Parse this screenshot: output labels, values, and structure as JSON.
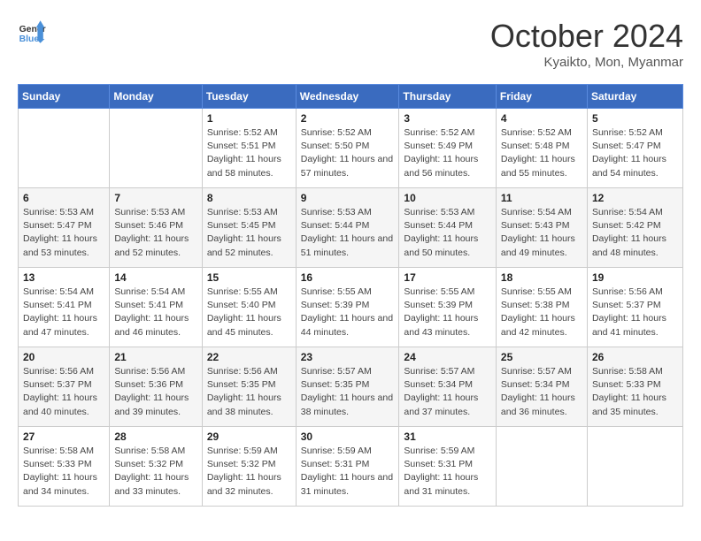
{
  "header": {
    "logo_line1": "General",
    "logo_line2": "Blue",
    "month": "October 2024",
    "location": "Kyaikto, Mon, Myanmar"
  },
  "days_of_week": [
    "Sunday",
    "Monday",
    "Tuesday",
    "Wednesday",
    "Thursday",
    "Friday",
    "Saturday"
  ],
  "weeks": [
    [
      {
        "day": "",
        "sunrise": "",
        "sunset": "",
        "daylight": ""
      },
      {
        "day": "",
        "sunrise": "",
        "sunset": "",
        "daylight": ""
      },
      {
        "day": "1",
        "sunrise": "Sunrise: 5:52 AM",
        "sunset": "Sunset: 5:51 PM",
        "daylight": "Daylight: 11 hours and 58 minutes."
      },
      {
        "day": "2",
        "sunrise": "Sunrise: 5:52 AM",
        "sunset": "Sunset: 5:50 PM",
        "daylight": "Daylight: 11 hours and 57 minutes."
      },
      {
        "day": "3",
        "sunrise": "Sunrise: 5:52 AM",
        "sunset": "Sunset: 5:49 PM",
        "daylight": "Daylight: 11 hours and 56 minutes."
      },
      {
        "day": "4",
        "sunrise": "Sunrise: 5:52 AM",
        "sunset": "Sunset: 5:48 PM",
        "daylight": "Daylight: 11 hours and 55 minutes."
      },
      {
        "day": "5",
        "sunrise": "Sunrise: 5:52 AM",
        "sunset": "Sunset: 5:47 PM",
        "daylight": "Daylight: 11 hours and 54 minutes."
      }
    ],
    [
      {
        "day": "6",
        "sunrise": "Sunrise: 5:53 AM",
        "sunset": "Sunset: 5:47 PM",
        "daylight": "Daylight: 11 hours and 53 minutes."
      },
      {
        "day": "7",
        "sunrise": "Sunrise: 5:53 AM",
        "sunset": "Sunset: 5:46 PM",
        "daylight": "Daylight: 11 hours and 52 minutes."
      },
      {
        "day": "8",
        "sunrise": "Sunrise: 5:53 AM",
        "sunset": "Sunset: 5:45 PM",
        "daylight": "Daylight: 11 hours and 52 minutes."
      },
      {
        "day": "9",
        "sunrise": "Sunrise: 5:53 AM",
        "sunset": "Sunset: 5:44 PM",
        "daylight": "Daylight: 11 hours and 51 minutes."
      },
      {
        "day": "10",
        "sunrise": "Sunrise: 5:53 AM",
        "sunset": "Sunset: 5:44 PM",
        "daylight": "Daylight: 11 hours and 50 minutes."
      },
      {
        "day": "11",
        "sunrise": "Sunrise: 5:54 AM",
        "sunset": "Sunset: 5:43 PM",
        "daylight": "Daylight: 11 hours and 49 minutes."
      },
      {
        "day": "12",
        "sunrise": "Sunrise: 5:54 AM",
        "sunset": "Sunset: 5:42 PM",
        "daylight": "Daylight: 11 hours and 48 minutes."
      }
    ],
    [
      {
        "day": "13",
        "sunrise": "Sunrise: 5:54 AM",
        "sunset": "Sunset: 5:41 PM",
        "daylight": "Daylight: 11 hours and 47 minutes."
      },
      {
        "day": "14",
        "sunrise": "Sunrise: 5:54 AM",
        "sunset": "Sunset: 5:41 PM",
        "daylight": "Daylight: 11 hours and 46 minutes."
      },
      {
        "day": "15",
        "sunrise": "Sunrise: 5:55 AM",
        "sunset": "Sunset: 5:40 PM",
        "daylight": "Daylight: 11 hours and 45 minutes."
      },
      {
        "day": "16",
        "sunrise": "Sunrise: 5:55 AM",
        "sunset": "Sunset: 5:39 PM",
        "daylight": "Daylight: 11 hours and 44 minutes."
      },
      {
        "day": "17",
        "sunrise": "Sunrise: 5:55 AM",
        "sunset": "Sunset: 5:39 PM",
        "daylight": "Daylight: 11 hours and 43 minutes."
      },
      {
        "day": "18",
        "sunrise": "Sunrise: 5:55 AM",
        "sunset": "Sunset: 5:38 PM",
        "daylight": "Daylight: 11 hours and 42 minutes."
      },
      {
        "day": "19",
        "sunrise": "Sunrise: 5:56 AM",
        "sunset": "Sunset: 5:37 PM",
        "daylight": "Daylight: 11 hours and 41 minutes."
      }
    ],
    [
      {
        "day": "20",
        "sunrise": "Sunrise: 5:56 AM",
        "sunset": "Sunset: 5:37 PM",
        "daylight": "Daylight: 11 hours and 40 minutes."
      },
      {
        "day": "21",
        "sunrise": "Sunrise: 5:56 AM",
        "sunset": "Sunset: 5:36 PM",
        "daylight": "Daylight: 11 hours and 39 minutes."
      },
      {
        "day": "22",
        "sunrise": "Sunrise: 5:56 AM",
        "sunset": "Sunset: 5:35 PM",
        "daylight": "Daylight: 11 hours and 38 minutes."
      },
      {
        "day": "23",
        "sunrise": "Sunrise: 5:57 AM",
        "sunset": "Sunset: 5:35 PM",
        "daylight": "Daylight: 11 hours and 38 minutes."
      },
      {
        "day": "24",
        "sunrise": "Sunrise: 5:57 AM",
        "sunset": "Sunset: 5:34 PM",
        "daylight": "Daylight: 11 hours and 37 minutes."
      },
      {
        "day": "25",
        "sunrise": "Sunrise: 5:57 AM",
        "sunset": "Sunset: 5:34 PM",
        "daylight": "Daylight: 11 hours and 36 minutes."
      },
      {
        "day": "26",
        "sunrise": "Sunrise: 5:58 AM",
        "sunset": "Sunset: 5:33 PM",
        "daylight": "Daylight: 11 hours and 35 minutes."
      }
    ],
    [
      {
        "day": "27",
        "sunrise": "Sunrise: 5:58 AM",
        "sunset": "Sunset: 5:33 PM",
        "daylight": "Daylight: 11 hours and 34 minutes."
      },
      {
        "day": "28",
        "sunrise": "Sunrise: 5:58 AM",
        "sunset": "Sunset: 5:32 PM",
        "daylight": "Daylight: 11 hours and 33 minutes."
      },
      {
        "day": "29",
        "sunrise": "Sunrise: 5:59 AM",
        "sunset": "Sunset: 5:32 PM",
        "daylight": "Daylight: 11 hours and 32 minutes."
      },
      {
        "day": "30",
        "sunrise": "Sunrise: 5:59 AM",
        "sunset": "Sunset: 5:31 PM",
        "daylight": "Daylight: 11 hours and 31 minutes."
      },
      {
        "day": "31",
        "sunrise": "Sunrise: 5:59 AM",
        "sunset": "Sunset: 5:31 PM",
        "daylight": "Daylight: 11 hours and 31 minutes."
      },
      {
        "day": "",
        "sunrise": "",
        "sunset": "",
        "daylight": ""
      },
      {
        "day": "",
        "sunrise": "",
        "sunset": "",
        "daylight": ""
      }
    ]
  ]
}
